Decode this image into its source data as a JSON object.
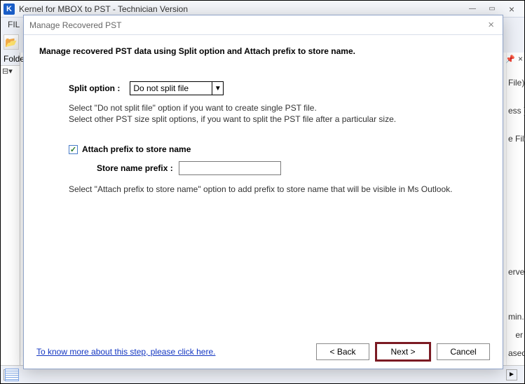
{
  "app": {
    "title": "Kernel for MBOX to PST - Technician Version",
    "menu_fragment": "FIL",
    "folders_label": "Folde",
    "tree_stub": "⊟▾",
    "right_strip": {
      "file": "File)",
      "ess": "ess )",
      "efile": "e File",
      "erver": "erver",
      "min": "min.",
      "er": "er",
      "ased": "ased I"
    }
  },
  "dialog": {
    "title": "Manage Recovered PST",
    "heading": "Manage recovered PST data using Split option and Attach prefix to store name.",
    "split": {
      "label": "Split option :",
      "selected": "Do not split file",
      "hint_line1": "Select \"Do not split file\" option if you want to create single PST file.",
      "hint_line2": "Select other PST size split options, if you want to split the PST file after a particular size."
    },
    "prefix": {
      "checkbox_label": "Attach prefix to store name",
      "checked_glyph": "✓",
      "field_label": "Store name prefix :",
      "value": "",
      "hint": "Select \"Attach prefix to store name\" option to add prefix to store name that will be visible in Ms Outlook."
    },
    "link": "To know more about this step, please click here.",
    "buttons": {
      "back": "< Back",
      "next": "Next >",
      "cancel": "Cancel"
    }
  }
}
